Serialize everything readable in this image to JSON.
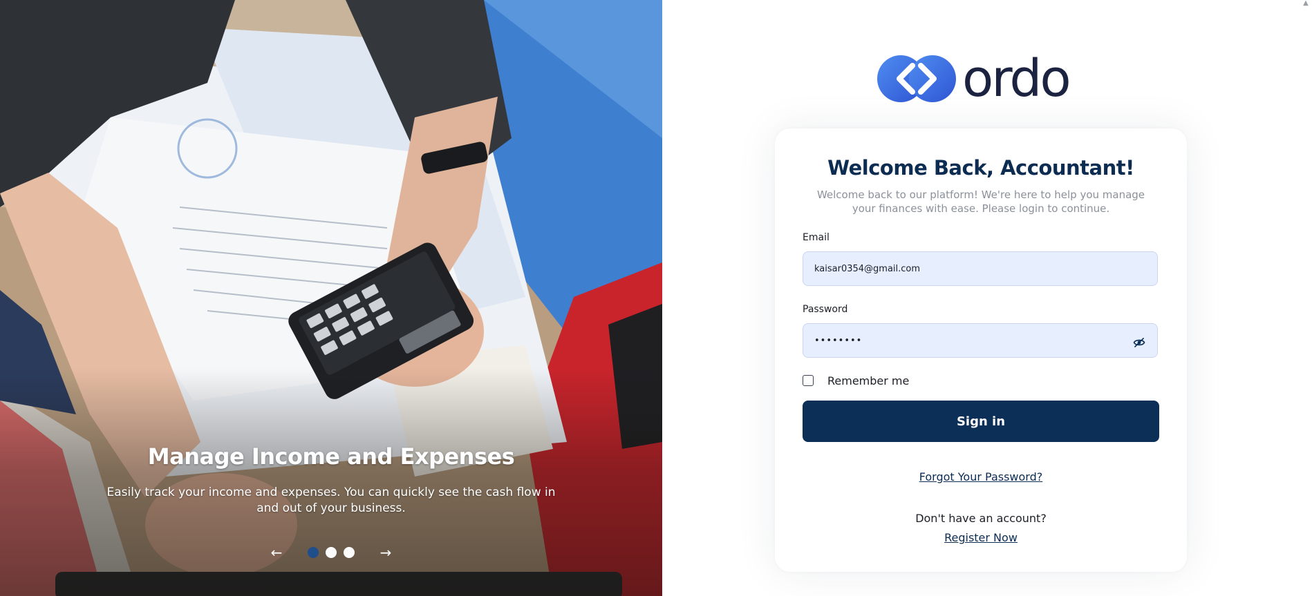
{
  "hero": {
    "title": "Manage Income and Expenses",
    "text": "Easily track your income and expenses. You can quickly see the cash flow in and out of your business.",
    "prev_arrow": "←",
    "next_arrow": "→",
    "slide_count": 3,
    "active_slide": 1
  },
  "brand": {
    "logo_text": "ordo",
    "accent_color": "#3b6fe0",
    "primary_color": "#0c2f57"
  },
  "login": {
    "title": "Welcome Back, Accountant!",
    "subtitle": "Welcome back to our platform! We're here to help you manage your finances with ease. Please login to continue.",
    "email_label": "Email",
    "email_value": "kaisar0354@gmail.com",
    "password_label": "Password",
    "password_value": "••••••••",
    "remember_label": "Remember me",
    "remember_checked": false,
    "signin_label": "Sign in",
    "forgot_label": "Forgot Your Password?",
    "no_account_text": "Don't have an account?",
    "register_label": "Register Now"
  },
  "icons": {
    "password_toggle": "eye-off-icon",
    "scroll_up": "scroll-up-arrow-icon"
  }
}
